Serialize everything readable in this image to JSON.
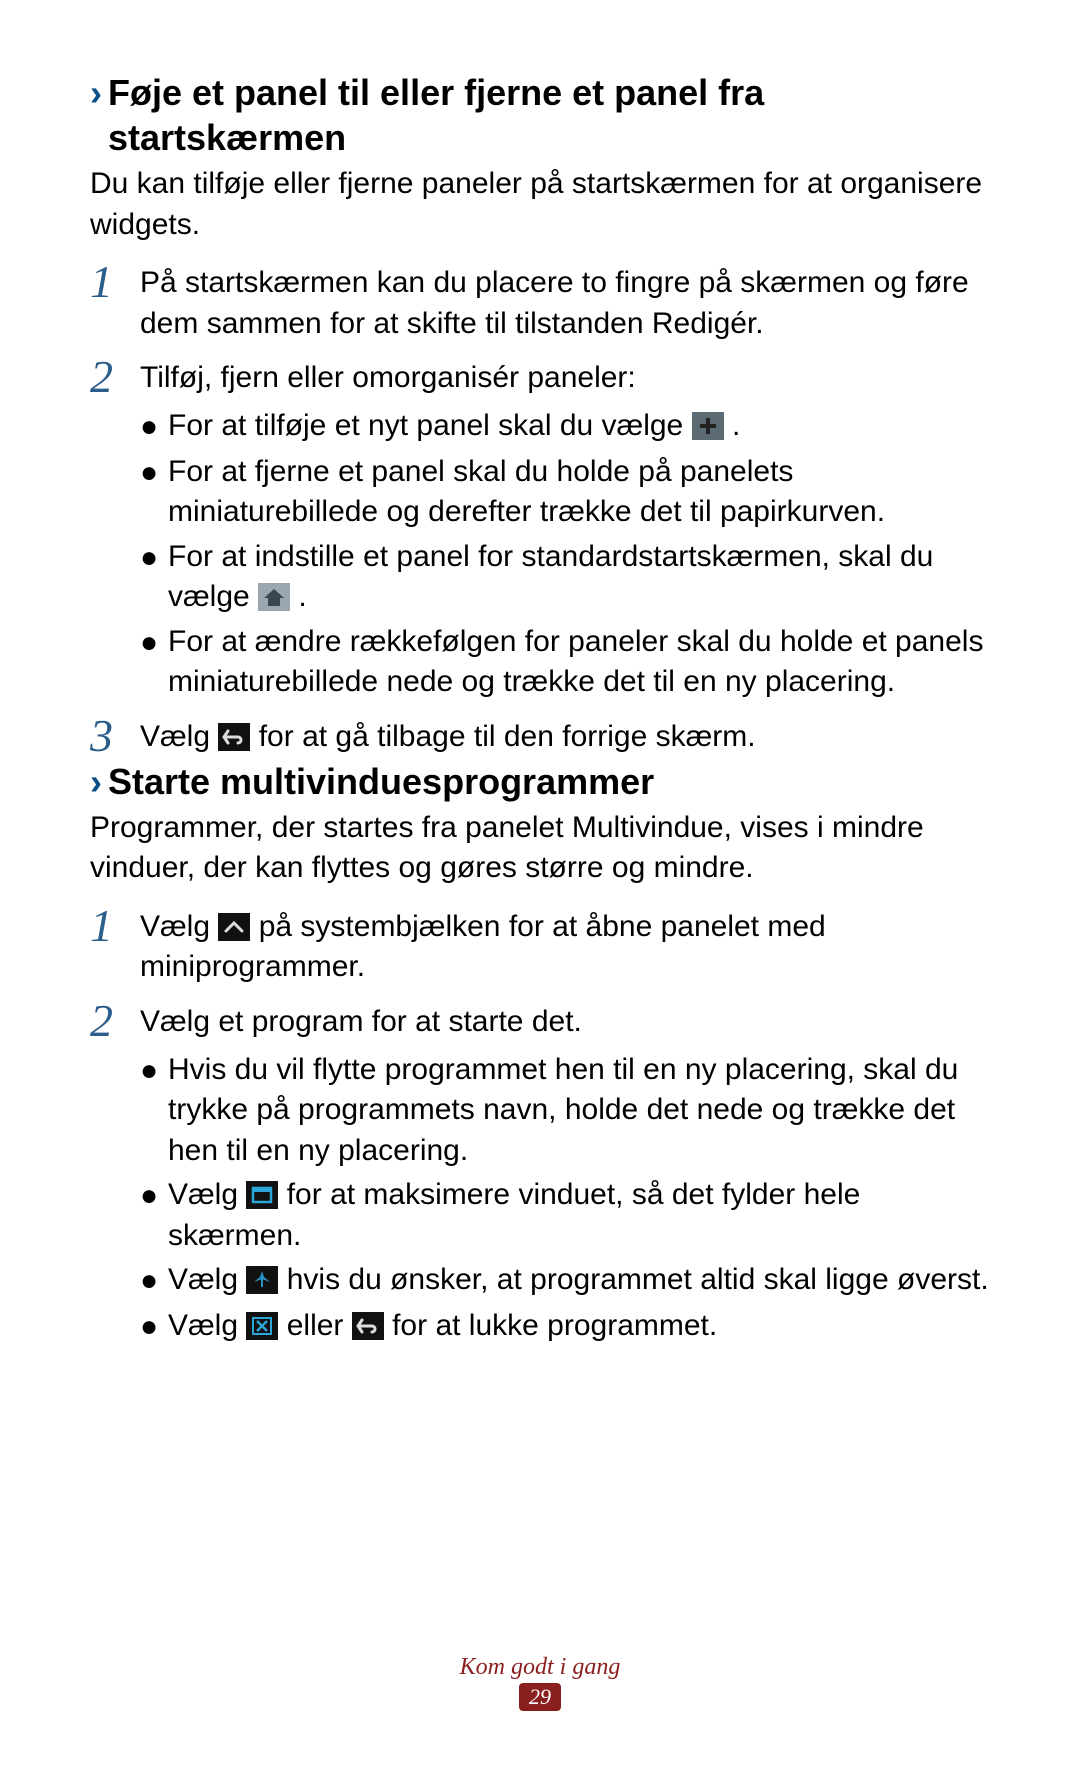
{
  "section1": {
    "title": "Føje et panel til eller fjerne et panel fra startskærmen",
    "intro": "Du kan tilføje eller fjerne paneler på startskærmen for at organisere widgets.",
    "step1": "På startskærmen kan du placere to fingre på skærmen og føre dem sammen for at skifte til tilstanden Redigér.",
    "step2": "Tilføj, fjern eller omorganisér paneler:",
    "step2_bullets": {
      "b1_a": "For at tilføje et nyt panel skal du vælge ",
      "b1_b": ".",
      "b2": "For at fjerne et panel skal du holde på panelets miniaturebillede og derefter trække det til papirkurven.",
      "b3_a": "For at indstille et panel for standardstartskærmen, skal du vælge ",
      "b3_b": ".",
      "b4": "For at ændre rækkefølgen for paneler skal du holde et panels miniaturebillede nede og trække det til en ny placering."
    },
    "step3_a": "Vælg ",
    "step3_b": " for at gå tilbage til den forrige skærm."
  },
  "section2": {
    "title": "Starte multivinduesprogrammer",
    "intro": "Programmer, der startes fra panelet Multivindue, vises i mindre vinduer, der kan flyttes og gøres større og mindre.",
    "step1_a": "Vælg ",
    "step1_b": " på systembjælken for at åbne panelet med miniprogrammer.",
    "step2": "Vælg et program for at starte det.",
    "step2_bullets": {
      "b1": "Hvis du vil flytte programmet hen til en ny placering, skal du trykke på programmets navn, holde det nede og trække det hen til en ny placering.",
      "b2_a": "Vælg ",
      "b2_b": " for at maksimere vinduet, så det fylder hele skærmen.",
      "b3_a": "Vælg ",
      "b3_b": " hvis du ønsker, at programmet altid skal ligge øverst.",
      "b4_a": "Vælg ",
      "b4_b": " eller ",
      "b4_c": " for at lukke programmet."
    }
  },
  "footer": {
    "label": "Kom godt i gang",
    "page": "29"
  },
  "nums": {
    "n1": "1",
    "n2": "2",
    "n3": "3"
  },
  "icons": {
    "plus": "plus-icon",
    "home": "home-icon",
    "back": "back-icon",
    "up": "chevron-up-icon",
    "maximize": "maximize-icon",
    "pin": "pin-icon",
    "close": "close-x-icon"
  }
}
